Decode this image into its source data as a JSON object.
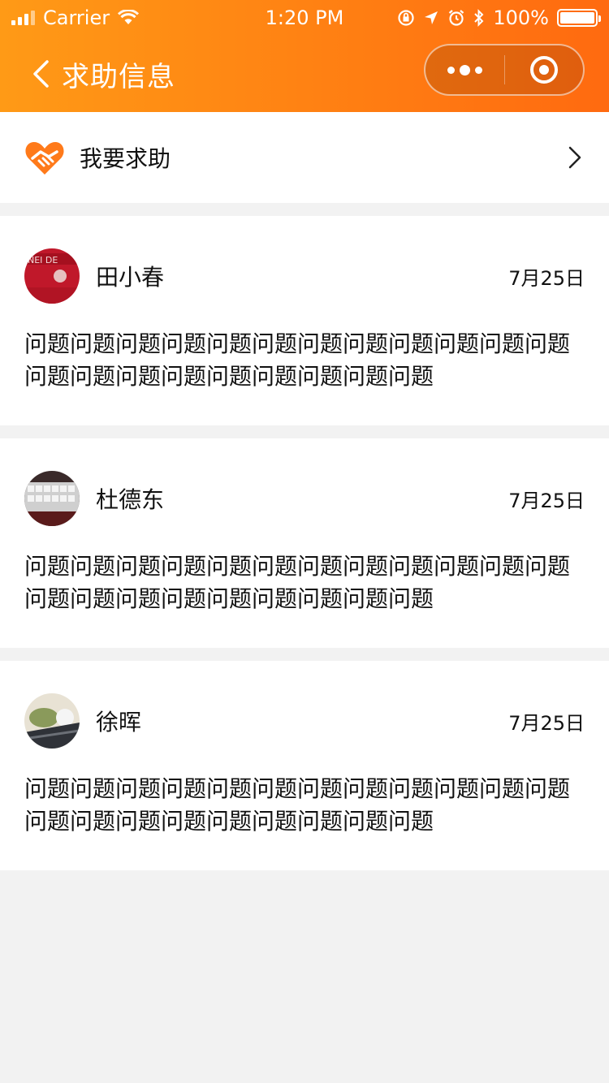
{
  "status_bar": {
    "carrier": "Carrier",
    "time": "1:20 PM",
    "battery": "100%"
  },
  "nav": {
    "title": "求助信息"
  },
  "help_entry": {
    "label": "我要求助"
  },
  "posts": [
    {
      "name": "田小春",
      "date": "7月25日",
      "content": "问题问题问题问题问题问题问题问题问题问题问题问题问题问题问题问题问题问题问题问题问题"
    },
    {
      "name": "杜德东",
      "date": "7月25日",
      "content": "问题问题问题问题问题问题问题问题问题问题问题问题问题问题问题问题问题问题问题问题问题"
    },
    {
      "name": "徐晖",
      "date": "7月25日",
      "content": "问题问题问题问题问题问题问题问题问题问题问题问题问题问题问题问题问题问题问题问题问题"
    }
  ],
  "colors": {
    "accent_start": "#ff9a16",
    "accent_end": "#ff6a10",
    "background": "#f2f2f2",
    "card": "#ffffff"
  },
  "icons": [
    "signal-icon",
    "wifi-icon",
    "orientation-lock-icon",
    "location-arrow-icon",
    "alarm-icon",
    "bluetooth-icon",
    "battery-icon",
    "back-chevron-icon",
    "more-dots-icon",
    "target-close-icon",
    "helping-hands-heart-icon",
    "chevron-right-icon"
  ]
}
